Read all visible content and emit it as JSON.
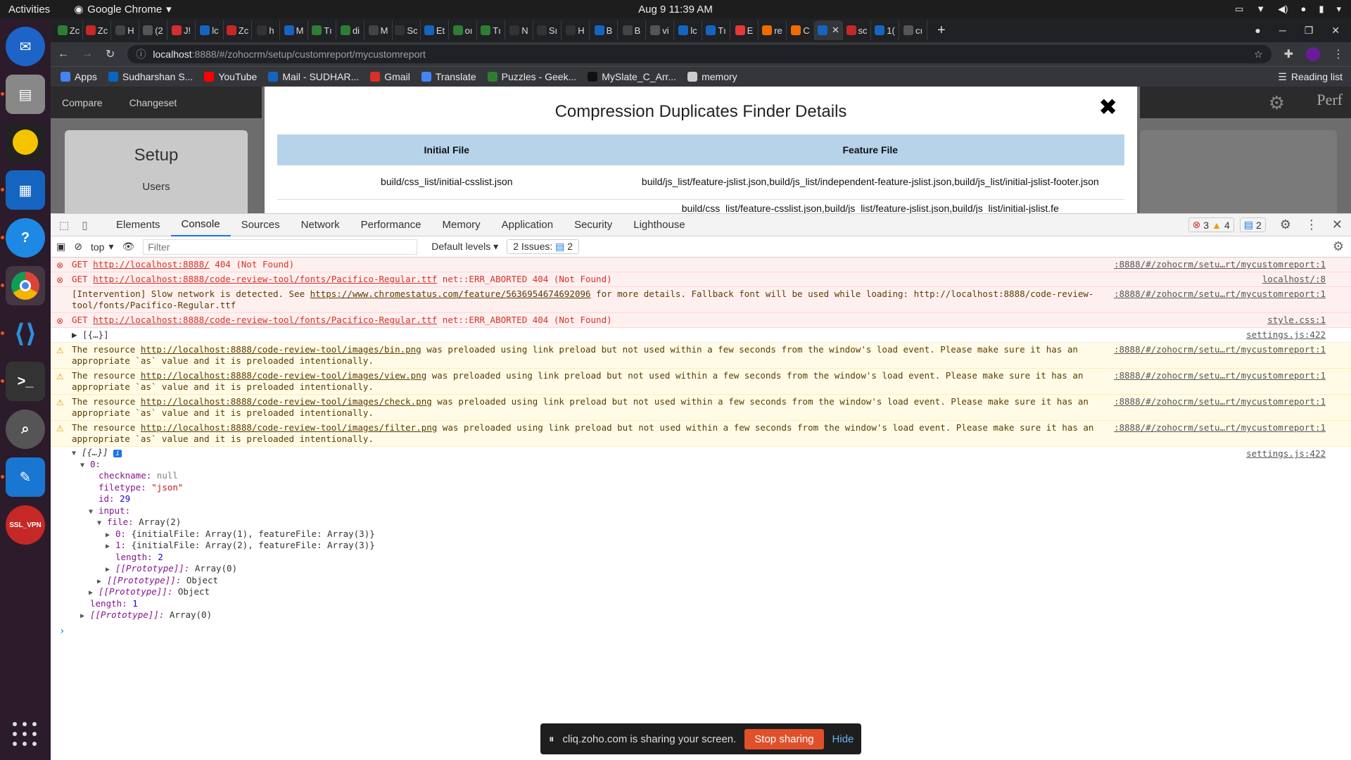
{
  "topbar": {
    "activities": "Activities",
    "app": "Google Chrome",
    "clock": "Aug 9  11:39 AM"
  },
  "tabs": [
    "Zc",
    "Zc",
    "H",
    "(2",
    "J!",
    "lc",
    "Zc",
    "h",
    "M",
    "Tı",
    "di",
    "M",
    "Sc",
    "Et",
    "oı",
    "Tı",
    "N",
    "Sı",
    "H",
    "B",
    "B",
    "vi",
    "lc",
    "Tı",
    "E",
    "re",
    "C",
    "",
    "sc",
    "1(",
    "cı"
  ],
  "tab_colors": [
    "#2e7d32",
    "#c62828",
    "#444",
    "#555",
    "#d32f2f",
    "#1565c0",
    "#c62828",
    "#333",
    "#1565c0",
    "#2e7d32",
    "#2e7d32",
    "#444",
    "#333",
    "#1565c0",
    "#2e7d32",
    "#2e7d32",
    "#333",
    "#333",
    "#333",
    "#1565c0",
    "#444",
    "#555",
    "#1565c0",
    "#1565c0",
    "#e53935",
    "#ef6c00",
    "#ef6c00",
    "#1565c0",
    "#c62828",
    "#1565c0",
    "#555"
  ],
  "url": {
    "host": "localhost",
    "path": ":8888/#/zohocrm/setup/customreport/mycustomreport"
  },
  "bookmarks": [
    {
      "label": "Apps",
      "color": "#4285f4"
    },
    {
      "label": "Sudharshan S...",
      "color": "#0a66c2"
    },
    {
      "label": "YouTube",
      "color": "#ff0000"
    },
    {
      "label": "Mail - SUDHAR...",
      "color": "#1565c0"
    },
    {
      "label": "Gmail",
      "color": "#d93025"
    },
    {
      "label": "Translate",
      "color": "#4285f4"
    },
    {
      "label": "Puzzles - Geek...",
      "color": "#2e7d32"
    },
    {
      "label": "MySlate_C_Arr...",
      "color": "#111"
    },
    {
      "label": "memory",
      "color": "#ccc"
    }
  ],
  "reading_list": "Reading list",
  "app": {
    "nav": [
      "Compare",
      "Changeset"
    ],
    "perf": "Perf",
    "setup_title": "Setup",
    "setup_item": "Users"
  },
  "modal": {
    "title": "Compression Duplicates Finder Details",
    "close": "✖",
    "headers": [
      "Initial File",
      "Feature File"
    ],
    "rows": [
      [
        "build/css_list/initial-csslist.json",
        "build/js_list/feature-jslist.json,build/js_list/independent-feature-jslist.json,build/js_list/initial-jslist-footer.json"
      ],
      [
        "",
        "build/css_list/feature-csslist.json,build/js_list/feature-jslist.json,build/js_list/initial-jslist.fe"
      ]
    ]
  },
  "devtools": {
    "tabs": [
      "Elements",
      "Console",
      "Sources",
      "Network",
      "Performance",
      "Memory",
      "Application",
      "Security",
      "Lighthouse"
    ],
    "active_tab": "Console",
    "errors": "3",
    "warnings": "4",
    "messages": "2",
    "context": "top",
    "filter_placeholder": "Filter",
    "levels": "Default levels",
    "issues_label": "2 Issues:",
    "issues_count": "2"
  },
  "console": [
    {
      "type": "err",
      "prefix": "GET ",
      "link": "http://localhost:8888/",
      "text": " 404 (Not Found)",
      "src": ":8888/#/zohocrm/setu…rt/mycustomreport:1"
    },
    {
      "type": "err",
      "prefix": "GET ",
      "link": "http://localhost:8888/code-review-tool/fonts/Pacifico-Regular.ttf",
      "text": " net::ERR_ABORTED 404 (Not Found)",
      "src": "localhost/:8"
    },
    {
      "type": "err",
      "prefix": "[Intervention] Slow network is detected. See ",
      "link": "https://www.chromestatus.com/feature/5636954674692096",
      "text": " for more details. Fallback font will be used while loading: http://localhost:8888/code-review-tool/fonts/Pacifico-Regular.ttf",
      "src": ":8888/#/zohocrm/setu…rt/mycustomreport:1",
      "noicon": true
    },
    {
      "type": "err",
      "prefix": "GET ",
      "link": "http://localhost:8888/code-review-tool/fonts/Pacifico-Regular.ttf",
      "text": " net::ERR_ABORTED 404 (Not Found)",
      "src": "style.css:1"
    },
    {
      "type": "log",
      "prefix": "▶ [{…}]",
      "link": "",
      "text": "",
      "src": "settings.js:422"
    },
    {
      "type": "warn",
      "prefix": "The resource ",
      "link": "http://localhost:8888/code-review-tool/images/bin.png",
      "text": " was preloaded using link preload but not used within a few seconds from the window's load event. Please make sure it has an appropriate `as` value and it is preloaded intentionally.",
      "src": ":8888/#/zohocrm/setu…rt/mycustomreport:1"
    },
    {
      "type": "warn",
      "prefix": "The resource ",
      "link": "http://localhost:8888/code-review-tool/images/view.png",
      "text": " was preloaded using link preload but not used within a few seconds from the window's load event. Please make sure it has an appropriate `as` value and it is preloaded intentionally.",
      "src": ":8888/#/zohocrm/setu…rt/mycustomreport:1"
    },
    {
      "type": "warn",
      "prefix": "The resource ",
      "link": "http://localhost:8888/code-review-tool/images/check.png",
      "text": " was preloaded using link preload but not used within a few seconds from the window's load event. Please make sure it has an appropriate `as` value and it is preloaded intentionally.",
      "src": ":8888/#/zohocrm/setu…rt/mycustomreport:1"
    },
    {
      "type": "warn",
      "prefix": "The resource ",
      "link": "http://localhost:8888/code-review-tool/images/filter.png",
      "text": " was preloaded using link preload but not used within a few seconds from the window's load event. Please make sure it has an appropriate `as` value and it is preloaded intentionally.",
      "src": ":8888/#/zohocrm/setu…rt/mycustomreport:1"
    }
  ],
  "tree": {
    "src": "settings.js:422",
    "lines": [
      {
        "indent": 0,
        "tri": "▼",
        "html": "[{…}] <span style='color:#fff;background:#1a73e8;font-size:10px;padding:0 3px;border-radius:2px'>i</span>"
      },
      {
        "indent": 1,
        "tri": "▼",
        "key": "0",
        "val": "",
        "cls": ""
      },
      {
        "indent": 2,
        "tri": "",
        "key": "checkname",
        "val": "null",
        "cls": "nul"
      },
      {
        "indent": 2,
        "tri": "",
        "key": "filetype",
        "val": "\"json\"",
        "cls": "str"
      },
      {
        "indent": 2,
        "tri": "",
        "key": "id",
        "val": "29",
        "cls": "num"
      },
      {
        "indent": 2,
        "tri": "▼",
        "key": "input",
        "val": "",
        "cls": ""
      },
      {
        "indent": 3,
        "tri": "▼",
        "key": "file",
        "val": "Array(2)",
        "cls": ""
      },
      {
        "indent": 4,
        "tri": "▶",
        "key": "0",
        "val": "{initialFile: Array(1), featureFile: Array(3)}",
        "cls": ""
      },
      {
        "indent": 4,
        "tri": "▶",
        "key": "1",
        "val": "{initialFile: Array(2), featureFile: Array(3)}",
        "cls": ""
      },
      {
        "indent": 4,
        "tri": "",
        "key": "length",
        "val": "2",
        "cls": "num"
      },
      {
        "indent": 4,
        "tri": "▶",
        "key": "[[Prototype]]",
        "val": "Array(0)",
        "cls": "",
        "proto": true
      },
      {
        "indent": 3,
        "tri": "▶",
        "key": "[[Prototype]]",
        "val": "Object",
        "cls": "",
        "proto": true
      },
      {
        "indent": 2,
        "tri": "▶",
        "key": "[[Prototype]]",
        "val": "Object",
        "cls": "",
        "proto": true
      },
      {
        "indent": 1,
        "tri": "",
        "key": "length",
        "val": "1",
        "cls": "num"
      },
      {
        "indent": 1,
        "tri": "▶",
        "key": "[[Prototype]]",
        "val": "Array(0)",
        "cls": "",
        "proto": true
      }
    ]
  },
  "sharebar": {
    "text": "cliq.zoho.com is sharing your screen.",
    "stop": "Stop sharing",
    "hide": "Hide"
  }
}
